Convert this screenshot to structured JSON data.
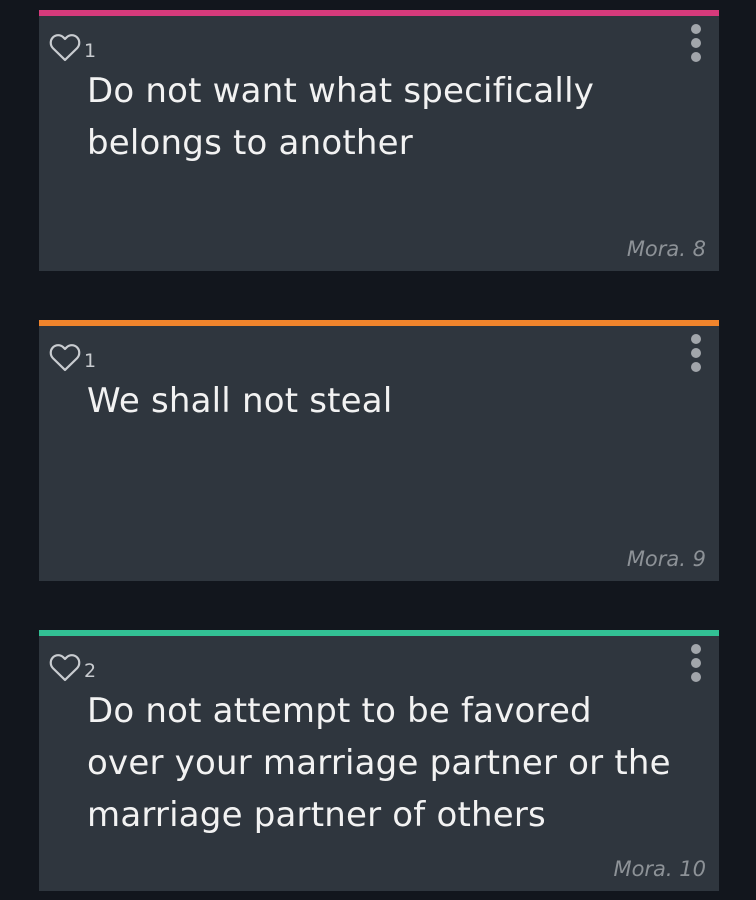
{
  "colors": {
    "background": "#12161d",
    "card": "#2f363e",
    "bar_pink": "#d63a7b",
    "bar_orange": "#f0842c",
    "bar_green": "#32c094"
  },
  "icons": {
    "like": "heart-outline-icon",
    "menu": "vertical-dots-icon"
  },
  "cards": [
    {
      "likes": "1",
      "text": "Do not want what specifically belongs to another",
      "reference": "Mora. 8"
    },
    {
      "likes": "1",
      "text": "We shall not steal",
      "reference": "Mora. 9"
    },
    {
      "likes": "2",
      "text": "Do not attempt to be favored over your marriage partner or the marriage partner of others",
      "reference": "Mora. 10"
    }
  ]
}
